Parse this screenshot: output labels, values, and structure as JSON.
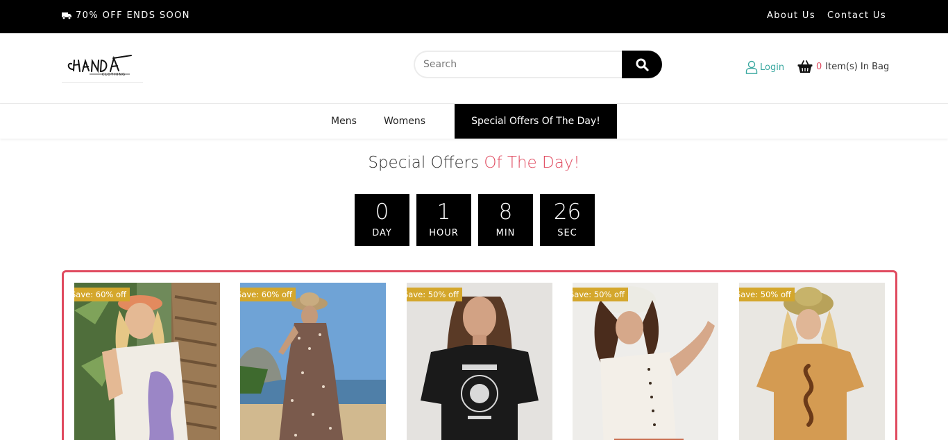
{
  "topbar": {
    "promo_text": "70% OFF ENDS SOON",
    "links": [
      "About Us",
      "Contact Us"
    ]
  },
  "header": {
    "logo_icon": "brand-logo",
    "search_placeholder": "Search",
    "login_label": "Login",
    "bag_count": "0",
    "bag_label": "Item(s) In Bag"
  },
  "nav": {
    "items": [
      "Mens",
      "Womens",
      "Special Offers Of The Day!"
    ],
    "active_index": 2
  },
  "offers": {
    "title_main": "Special Offers",
    "title_accent": "Of The Day!",
    "countdown": [
      {
        "value": "0",
        "label": "DAY"
      },
      {
        "value": "1",
        "label": "HOUR"
      },
      {
        "value": "8",
        "label": "MIN"
      },
      {
        "value": "26",
        "label": "SEC"
      }
    ]
  },
  "products": [
    {
      "badge": "Save: 60% off"
    },
    {
      "badge": "Save: 60% off"
    },
    {
      "badge": "Save: 50% off"
    },
    {
      "badge": "Save: 50% off"
    },
    {
      "badge": "Save: 50% off"
    }
  ],
  "colors": {
    "accent": "#e04a5f",
    "badge": "#d4a72c",
    "login": "#3aa8a0",
    "topbar": "#000000"
  }
}
